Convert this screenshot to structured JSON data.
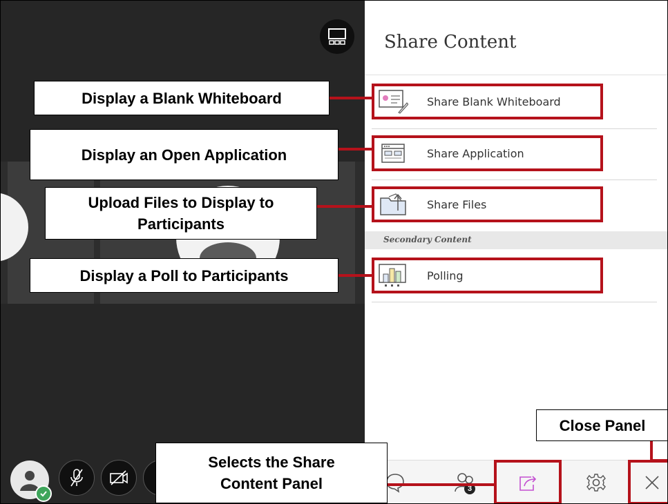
{
  "panel": {
    "title": "Share Content",
    "items": [
      {
        "label": "Share Blank Whiteboard",
        "icon": "whiteboard-icon"
      },
      {
        "label": "Share Application",
        "icon": "application-window-icon"
      },
      {
        "label": "Share Files",
        "icon": "folder-upload-icon"
      }
    ],
    "secondary_header": "Secondary Content",
    "secondary_items": [
      {
        "label": "Polling",
        "icon": "polling-chart-icon"
      }
    ]
  },
  "toolbar": {
    "participants_count": "3",
    "buttons": [
      "chat-icon",
      "participants-icon",
      "share-content-icon",
      "settings-icon",
      "close-icon"
    ]
  },
  "callouts": {
    "whiteboard": "Display a Blank Whiteboard",
    "application": "Display an Open Application",
    "files": "Upload Files to Display to Participants",
    "polling": "Display a Poll to Participants",
    "close": "Close Panel",
    "share": "Selects the Share Content Panel"
  },
  "colors": {
    "highlight": "#b5121b",
    "stage_bg": "#262626",
    "share_icon": "#c34fd1",
    "status_green": "#3fa55b"
  }
}
